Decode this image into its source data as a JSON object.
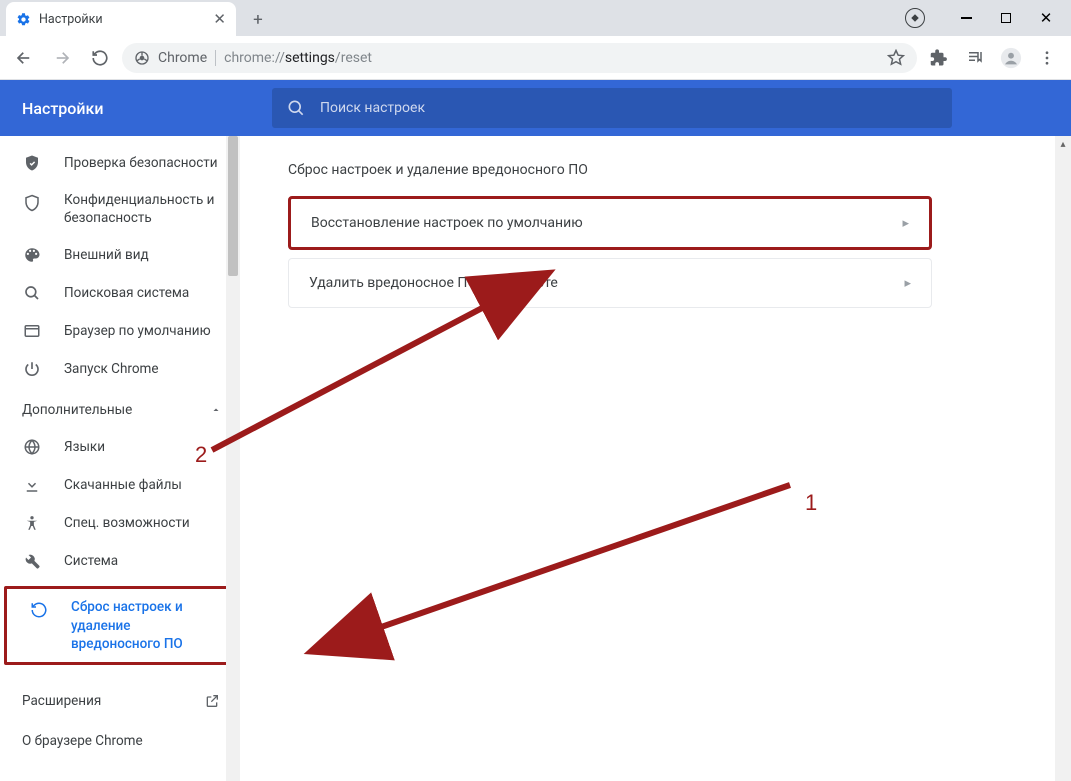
{
  "tab": {
    "title": "Настройки"
  },
  "url": {
    "label": "Chrome",
    "prefix": "chrome://",
    "bold": "settings",
    "suffix": "/reset"
  },
  "header": {
    "title": "Настройки"
  },
  "search": {
    "placeholder": "Поиск настроек"
  },
  "sidebar": {
    "items": [
      {
        "label": "Проверка безопасности"
      },
      {
        "label": "Конфиденциальность и безопасность"
      },
      {
        "label": "Внешний вид"
      },
      {
        "label": "Поисковая система"
      },
      {
        "label": "Браузер по умолчанию"
      },
      {
        "label": "Запуск Chrome"
      }
    ],
    "advanced_label": "Дополнительные",
    "adv_items": [
      {
        "label": "Языки"
      },
      {
        "label": "Скачанные файлы"
      },
      {
        "label": "Спец. возможности"
      },
      {
        "label": "Система"
      },
      {
        "label": "Сброс настроек и удаление вредоносного ПО"
      }
    ],
    "extensions": "Расширения",
    "about": "О браузере Chrome"
  },
  "main": {
    "title": "Сброс настроек и удаление вредоносного ПО",
    "option1": "Восстановление настроек по умолчанию",
    "option2": "Удалить вредоносное ПО с компьюте"
  },
  "annotations": {
    "label1": "1",
    "label2": "2"
  }
}
